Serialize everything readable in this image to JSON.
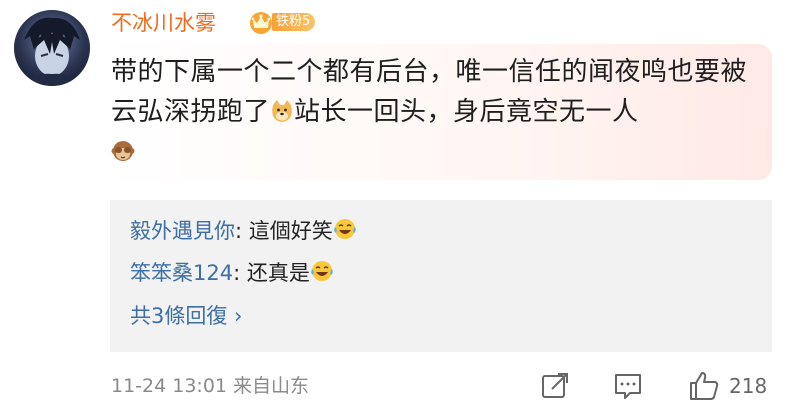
{
  "comment": {
    "username": "不冰川水雾",
    "badge_label": "铁粉5",
    "content_part1": "带的下属一个二个都有后台，唯一信任的闻夜鸣也要被云弘深拐跑了",
    "content_part2": "站长一回头，身后竟空无一人",
    "emoji_1": "doge-icon",
    "emoji_2": "see-no-evil-monkey-icon"
  },
  "replies": [
    {
      "author": "毅外遇見你",
      "separator": ": ",
      "text": "這個好笑",
      "emoji": "laugh-tears-icon"
    },
    {
      "author": "笨笨桑124",
      "separator": ": ",
      "text": "还真是",
      "emoji": "laugh-tears-icon"
    }
  ],
  "more_replies": "共3條回復 ›",
  "footer": {
    "time_location": "11-24 13:01  来自山东",
    "like_count": "218"
  },
  "colors": {
    "username": "#f26b1d",
    "link": "#3c6fa6",
    "reply_bg": "#f2f2f2"
  }
}
